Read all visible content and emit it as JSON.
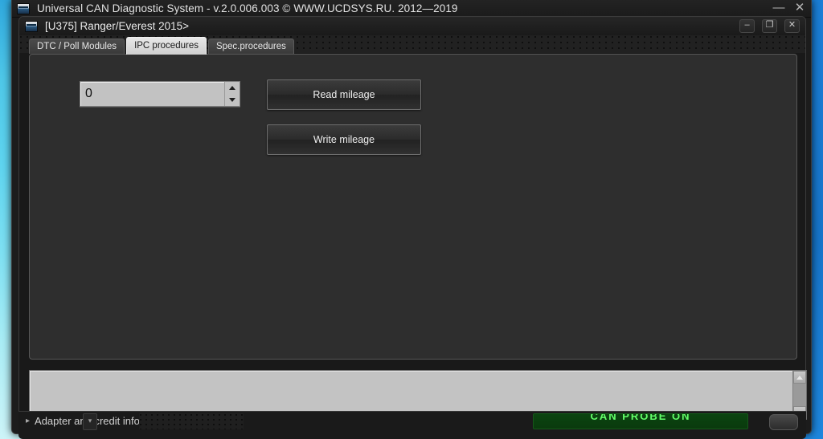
{
  "outer_window": {
    "title": "Universal CAN Diagnostic System -  v.2.0.006.003 © WWW.UCDSYS.RU. 2012—2019",
    "icon": "ucds-logo-icon",
    "controls": {
      "minimize": "—",
      "close": "✕"
    }
  },
  "inner_window": {
    "title": "[U375] Ranger/Everest 2015>",
    "icon": "ucds-logo-icon",
    "controls": {
      "minimize": "‒",
      "maximize": "❐",
      "close": "✕"
    }
  },
  "tabs": [
    {
      "label": "DTC / Poll Modules",
      "active": false
    },
    {
      "label": "IPC procedures",
      "active": true
    },
    {
      "label": "Spec.procedures",
      "active": false
    }
  ],
  "ipc_panel": {
    "mileage_input": {
      "value": "0",
      "placeholder": "0",
      "spin_up_icon": "triangle-up-icon",
      "spin_down_icon": "triangle-down-icon"
    },
    "read_button": "Read mileage",
    "write_button": "Write mileage"
  },
  "log_panel": {
    "text": "",
    "scroll_up_icon": "scroll-up-arrow-icon",
    "scroll_down_icon": "scroll-down-arrow-icon"
  },
  "footer": {
    "chevron_icon": "chevron-right-icon",
    "label": "Adapter and credit information",
    "status": "CAN PROBE ON",
    "small_button": "▾"
  },
  "colors": {
    "accent_blue": "#1878d0",
    "panel_dark": "#2e2e2e",
    "window_dark": "#191919",
    "log_gray": "#c3c3c3",
    "status_green": "#63ff6a",
    "active_tab": "#e8e8e8"
  }
}
